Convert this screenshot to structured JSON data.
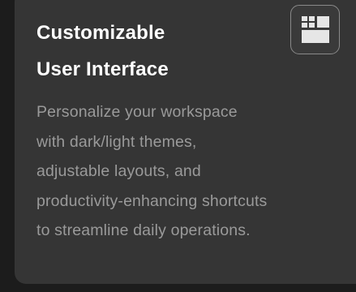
{
  "card": {
    "title_line1": "Customizable",
    "title_line2": "User Interface",
    "description_lines": [
      "Personalize your workspace",
      "with dark/light themes,",
      "adjustable layouts, and",
      "productivity-enhancing shortcuts",
      "to streamline daily operations."
    ],
    "icon": "layout-grid-icon"
  },
  "colors": {
    "background": "#1c1c1c",
    "card": "#353535",
    "title": "#ffffff",
    "description": "#9a9a9a",
    "icon_border": "#8a8a8a",
    "icon_fill": "#e6e6e6"
  }
}
